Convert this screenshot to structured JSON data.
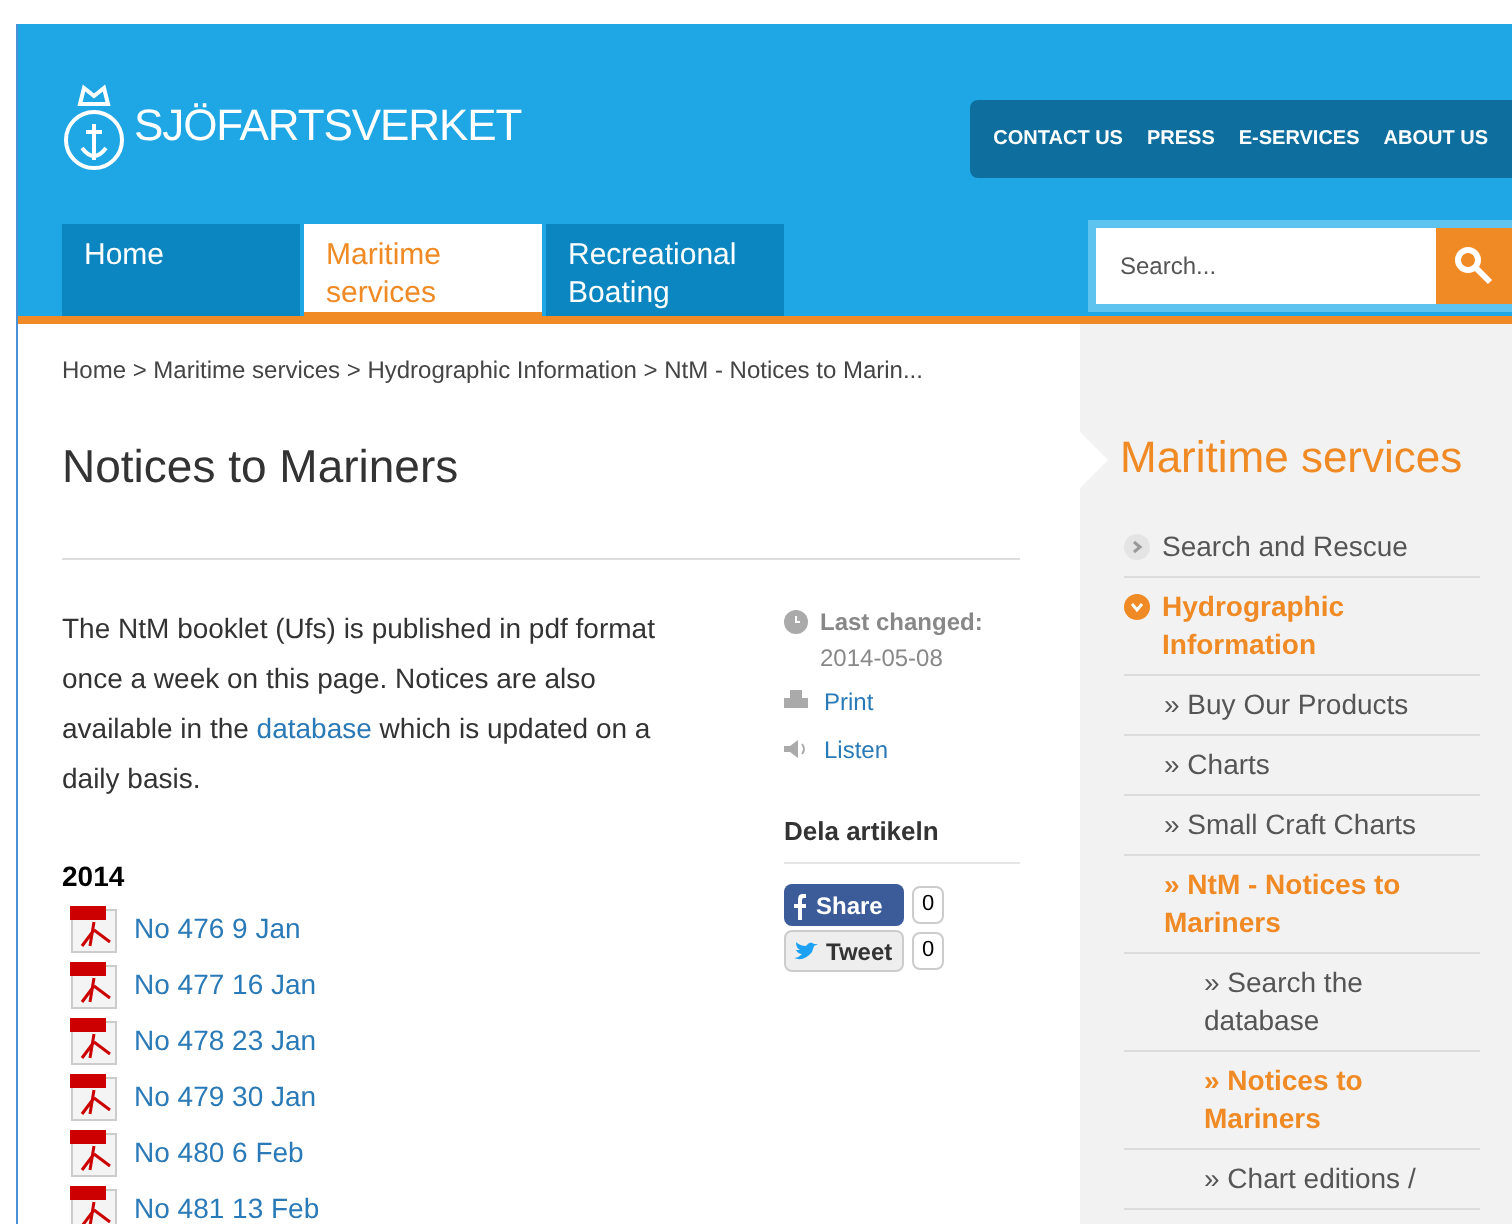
{
  "header": {
    "logo": "SJÖFARTSVERKET",
    "top_links": [
      "CONTACT US",
      "PRESS",
      "E-SERVICES",
      "ABOUT US"
    ],
    "tabs": [
      {
        "label": "Home",
        "selected": false
      },
      {
        "label": "Maritime services",
        "selected": true
      },
      {
        "label": "Recreational Boating",
        "selected": false
      }
    ],
    "search": {
      "placeholder": "Search..."
    }
  },
  "breadcrumb": "Home > Maritime services > Hydrographic Information > NtM - Notices to Marin...",
  "title": "Notices to Mariners",
  "intro": [
    "The NtM booklet (Ufs) is published in pdf format once a week on this page. Notices are also available in the ",
    "database",
    " which is updated on a daily basis."
  ],
  "meta": {
    "last_changed_label": "Last changed:",
    "last_changed": "2014-05-08",
    "print": "Print",
    "listen": "Listen"
  },
  "share": {
    "heading": "Dela artikeln",
    "buttons": [
      {
        "kind": "facebook",
        "label": "Share",
        "count": "0"
      },
      {
        "kind": "twitter",
        "label": "Tweet",
        "count": "0"
      }
    ]
  },
  "year": "2014",
  "documents": [
    "No 476 9 Jan",
    "No 477 16 Jan",
    "No 478 23 Jan",
    "No 479 30 Jan",
    "No 480 6 Feb",
    "No 481 13 Feb"
  ],
  "sidebar": {
    "title": "Maritime services",
    "items": [
      {
        "label": "Search and Rescue",
        "selected": false,
        "expanded": false
      },
      {
        "label": "Hydrographic Information",
        "selected": true,
        "expanded": true,
        "children": [
          {
            "label": "» Buy Our Products",
            "selected": false
          },
          {
            "label": "» Charts",
            "selected": false
          },
          {
            "label": "» Small Craft Charts",
            "selected": false
          },
          {
            "label": "» NtM - Notices to Mariners",
            "selected": true,
            "children": [
              {
                "label": "» Search the database",
                "selected": false
              },
              {
                "label": "» Notices to Mariners",
                "selected": true
              },
              {
                "label": "» Chart editions /",
                "selected": false
              }
            ]
          }
        ]
      }
    ]
  }
}
